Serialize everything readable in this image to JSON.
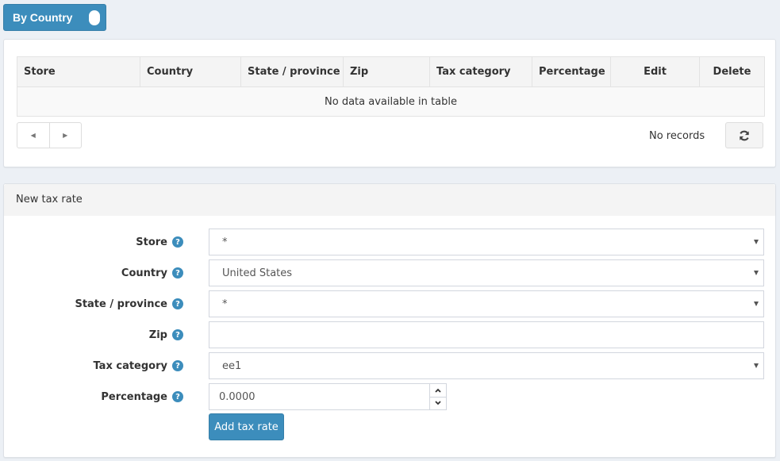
{
  "toggle": {
    "label": "By Country",
    "state": "on",
    "color": "#3c8dbc"
  },
  "table": {
    "columns": [
      "Store",
      "Country",
      "State / province",
      "Zip",
      "Tax category",
      "Percentage",
      "Edit",
      "Delete"
    ],
    "empty_message": "No data available in table",
    "pager": {
      "prev_icon": "◀",
      "next_icon": "▶"
    },
    "records_text": "No records"
  },
  "form": {
    "title": "New tax rate",
    "help_glyph": "?",
    "fields": [
      {
        "label": "Store",
        "value": "*",
        "type": "select"
      },
      {
        "label": "Country",
        "value": "United States",
        "type": "select"
      },
      {
        "label": "State / province",
        "value": "*",
        "type": "select"
      },
      {
        "label": "Zip",
        "value": "",
        "type": "text"
      },
      {
        "label": "Tax category",
        "value": "ee1",
        "type": "select"
      },
      {
        "label": "Percentage",
        "value": "0.0000",
        "type": "number"
      }
    ],
    "spin_up": "▲",
    "spin_down": "▼",
    "submit_label": "Add tax rate"
  }
}
